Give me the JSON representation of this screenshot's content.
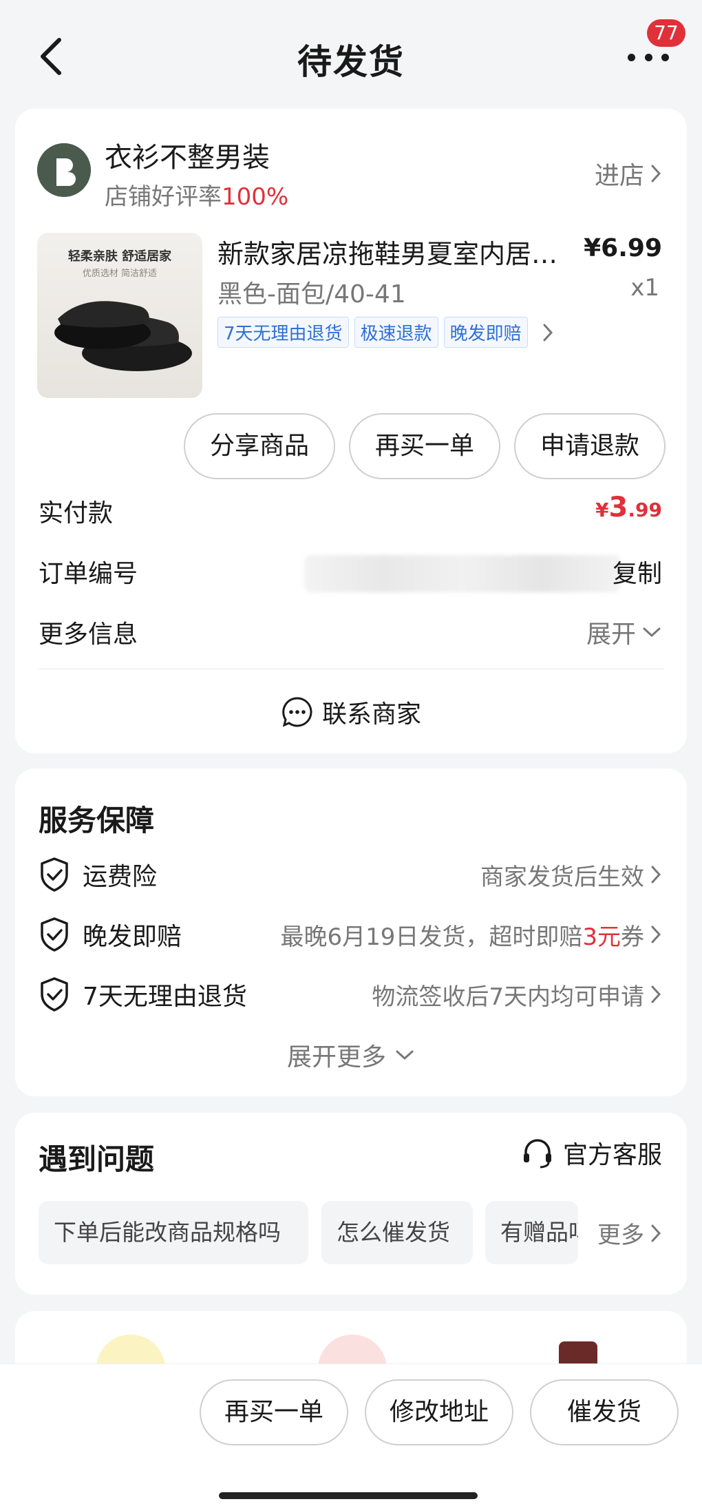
{
  "header": {
    "title": "待发货",
    "badge_count": "77"
  },
  "shop": {
    "name": "衣衫不整男装",
    "rating_label": "店铺好评率",
    "rating_value": "100%",
    "enter_label": "进店"
  },
  "product": {
    "image_caption_main": "轻柔亲肤 舒适居家",
    "image_caption_sub": "优质选材 简洁舒适",
    "title": "新款家居凉拖鞋男夏室内居家防滑拖鞋",
    "price": "¥6.99",
    "variant": "黑色-面包/40-41",
    "quantity": "x1",
    "tags": [
      "7天无理由退货",
      "极速退款",
      "晚发即赔"
    ]
  },
  "order_actions": {
    "share": "分享商品",
    "rebuy": "再买一单",
    "refund": "申请退款"
  },
  "order_info": {
    "paid_label": "实付款",
    "paid_currency": "¥",
    "paid_int": "3",
    "paid_dec": ".99",
    "order_no_label": "订单编号",
    "copy_label": "复制",
    "more_info_label": "更多信息",
    "expand_label": "展开",
    "contact_label": "联系商家"
  },
  "service": {
    "title": "服务保障",
    "items": [
      {
        "name": "运费险",
        "desc": "商家发货后生效"
      },
      {
        "name": "晚发即赔",
        "desc_pre": "最晚6月19日发货，超时即赔",
        "desc_red": "3元",
        "desc_post": "券"
      },
      {
        "name": "7天无理由退货",
        "desc": "物流签收后7天内均可申请"
      }
    ],
    "expand_more": "展开更多"
  },
  "faq": {
    "title": "遇到问题",
    "cs_label": "官方客服",
    "chips": [
      "下单后能改商品规格吗",
      "怎么催发货",
      "有赠品吗"
    ],
    "more_label": "更多"
  },
  "bottom": {
    "rebuy": "再买一单",
    "change_address": "修改地址",
    "urge_ship": "催发货"
  }
}
